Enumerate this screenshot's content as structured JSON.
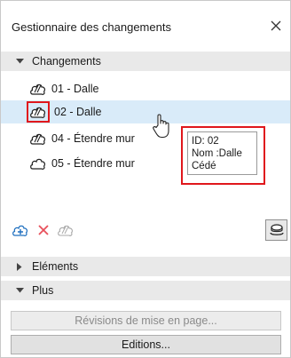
{
  "window": {
    "title": "Gestionnaire des changements",
    "close_glyph": "✕"
  },
  "sections": {
    "changements": {
      "label": "Changements",
      "state": "expanded"
    },
    "elements": {
      "label": "Eléments",
      "state": "collapsed"
    },
    "plus": {
      "label": "Plus",
      "state": "expanded"
    }
  },
  "changes": [
    {
      "label": "01 - Dalle",
      "icon": "change-linked-icon",
      "selected": false
    },
    {
      "label": "02 - Dalle",
      "icon": "change-linked-icon",
      "selected": true
    },
    {
      "label": "04 - Étendre mur",
      "icon": "change-linked-icon",
      "selected": false
    },
    {
      "label": "05 - Étendre mur",
      "icon": "cloud-icon",
      "selected": false
    }
  ],
  "tooltip": {
    "lines": [
      "ID: 02",
      "Nom :Dalle",
      "Cédé"
    ]
  },
  "toolbar": {
    "add_icon": "add-change-icon",
    "delete_icon": "delete-icon",
    "link_icon": "link-icon",
    "stack_icon": "marker-stack-icon"
  },
  "buttons": {
    "revisions": {
      "label": "Révisions de mise en page...",
      "enabled": false
    },
    "editions": {
      "label": "Editions...",
      "enabled": true
    }
  },
  "colors": {
    "highlight": "#e0171c",
    "selection": "#d9ebf9",
    "accent": "#1e6fbf",
    "delete": "#e8505b"
  }
}
